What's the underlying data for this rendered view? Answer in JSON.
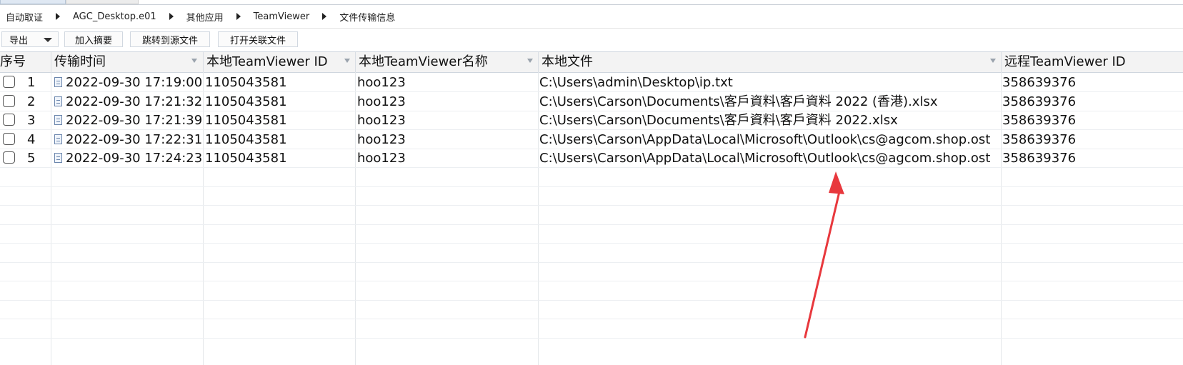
{
  "breadcrumb": [
    "自动取证",
    "AGC_Desktop.e01",
    "其他应用",
    "TeamViewer",
    "文件传输信息"
  ],
  "toolbar": {
    "export_label": "导出",
    "add_summary_label": "加入摘要",
    "jump_source_label": "跳转到源文件",
    "open_related_label": "打开关联文件"
  },
  "columns": [
    "序号",
    "传输时间",
    "本地TeamViewer ID",
    "本地TeamViewer名称",
    "本地文件",
    "远程TeamViewer ID"
  ],
  "rows": [
    {
      "index": "1",
      "time": "2022-09-30 17:19:00",
      "local_id": "1105043581",
      "local_name": "hoo123",
      "local_file": "C:\\Users\\admin\\Desktop\\ip.txt",
      "remote_id": "358639376"
    },
    {
      "index": "2",
      "time": "2022-09-30 17:21:32",
      "local_id": "1105043581",
      "local_name": "hoo123",
      "local_file": "C:\\Users\\Carson\\Documents\\客戶資料\\客戶資料 2022 (香港).xlsx",
      "remote_id": "358639376"
    },
    {
      "index": "3",
      "time": "2022-09-30 17:21:39",
      "local_id": "1105043581",
      "local_name": "hoo123",
      "local_file": "C:\\Users\\Carson\\Documents\\客戶資料\\客戶資料 2022.xlsx",
      "remote_id": "358639376"
    },
    {
      "index": "4",
      "time": "2022-09-30 17:22:31",
      "local_id": "1105043581",
      "local_name": "hoo123",
      "local_file": "C:\\Users\\Carson\\AppData\\Local\\Microsoft\\Outlook\\cs@agcom.shop.ost",
      "remote_id": "358639376"
    },
    {
      "index": "5",
      "time": "2022-09-30 17:24:23",
      "local_id": "1105043581",
      "local_name": "hoo123",
      "local_file": "C:\\Users\\Carson\\AppData\\Local\\Microsoft\\Outlook\\cs@agcom.shop.ost",
      "remote_id": "358639376"
    }
  ],
  "colors": {
    "annotation_arrow": "#e8383d",
    "header_bg": "#f3f3f3",
    "grid_line": "#e4e7ea"
  }
}
